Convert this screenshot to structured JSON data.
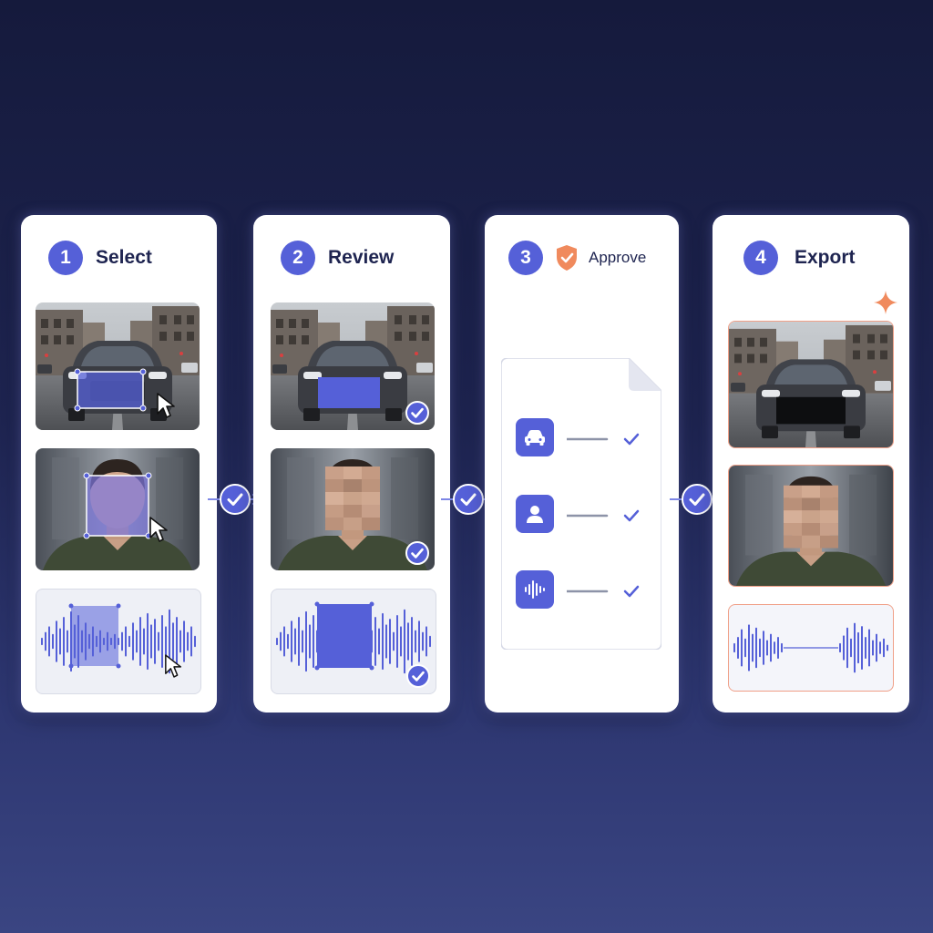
{
  "steps": [
    {
      "number": "1",
      "label": "Select"
    },
    {
      "number": "2",
      "label": "Review"
    },
    {
      "number": "3",
      "label": "Approve"
    },
    {
      "number": "4",
      "label": "Export"
    }
  ],
  "icons": {
    "connector": "check-circle-arrow-icon",
    "approve_badge": "shield-check-icon",
    "export_badge": "sparkle-icon",
    "doc_items": [
      "car-icon",
      "person-icon",
      "audio-wave-icon"
    ]
  },
  "colors": {
    "accent": "#5560d8",
    "heading": "#1e2450",
    "export_border": "#f0a088",
    "shield": "#f08a5d"
  }
}
